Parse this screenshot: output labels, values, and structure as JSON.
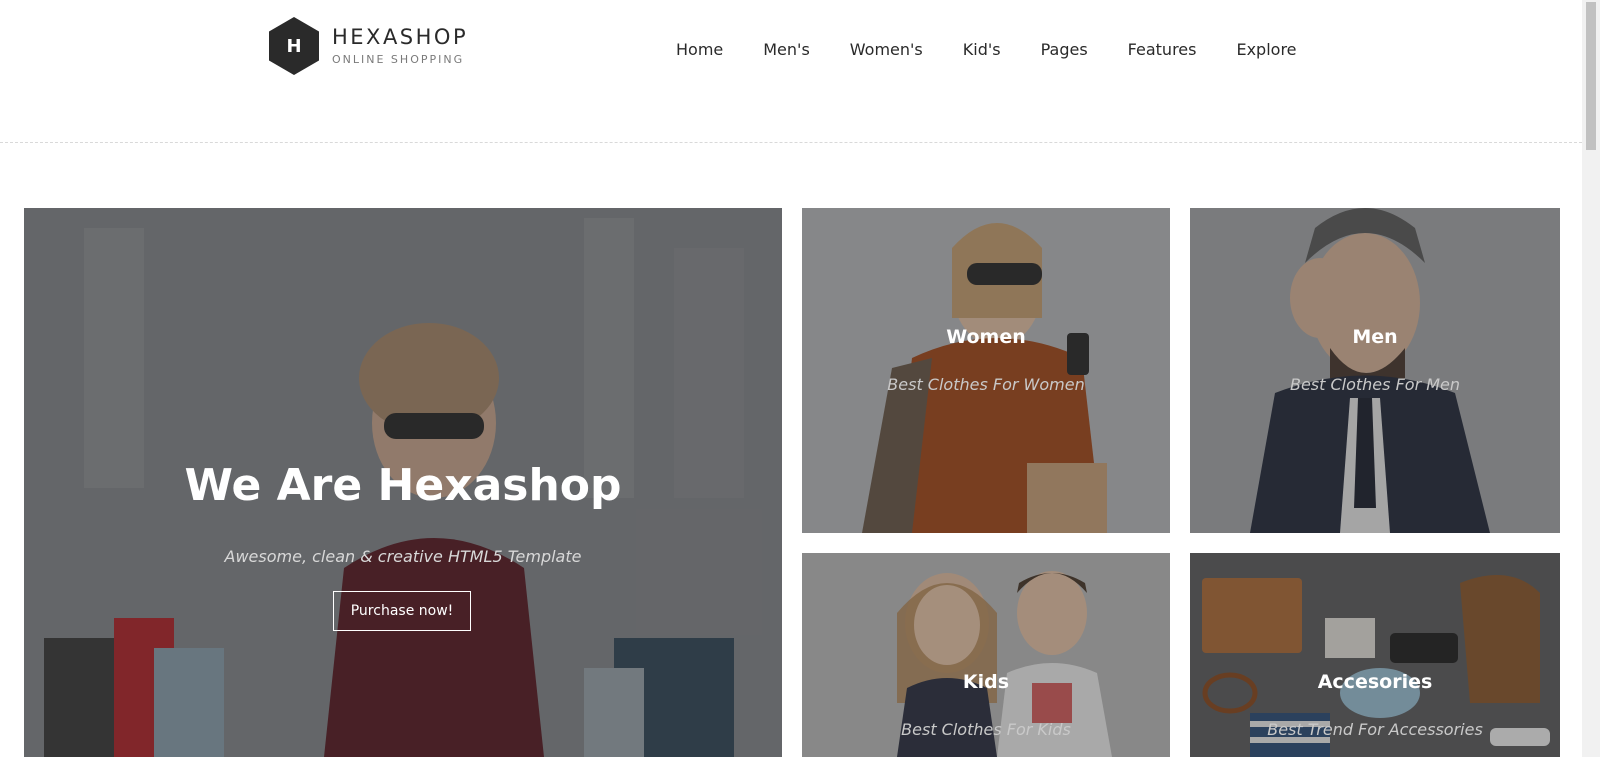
{
  "header": {
    "logo_letter": "H",
    "brand_name": "HEXASHOP",
    "tagline": "ONLINE SHOPPING",
    "nav": [
      {
        "label": "Home"
      },
      {
        "label": "Men's"
      },
      {
        "label": "Women's"
      },
      {
        "label": "Kid's"
      },
      {
        "label": "Pages"
      },
      {
        "label": "Features"
      },
      {
        "label": "Explore"
      }
    ]
  },
  "hero": {
    "title": "We Are Hexashop",
    "subtitle": "Awesome, clean & creative HTML5 Template",
    "button_label": "Purchase now!"
  },
  "categories": [
    {
      "title": "Women",
      "subtitle": "Best Clothes For Women"
    },
    {
      "title": "Men",
      "subtitle": "Best Clothes For Men"
    },
    {
      "title": "Kids",
      "subtitle": "Best Clothes For Kids"
    },
    {
      "title": "Accesories",
      "subtitle": "Best Trend For Accessories"
    }
  ],
  "colors": {
    "text_dark": "#2a2a2a",
    "overlay": "#282828"
  }
}
